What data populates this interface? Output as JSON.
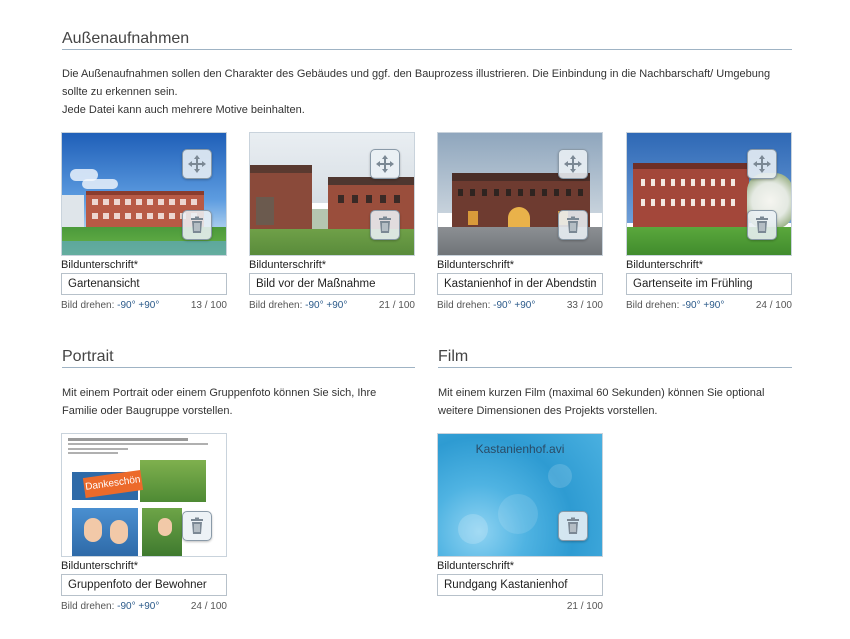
{
  "sections": {
    "exterior": {
      "title": "Außenaufnahmen",
      "description_line1": "Die Außenaufnahmen sollen den Charakter des Gebäudes und ggf. den Bauprozess illustrieren. Die Einbindung in die Nachbarschaft/ Umgebung",
      "description_line2": "sollte zu erkennen sein.",
      "description_line3": "Jede Datei kann auch mehrere Motive beinhalten."
    },
    "portrait": {
      "title": "Portrait",
      "description_line1": "Mit einem Portrait oder einem Gruppenfoto können Sie sich, Ihre",
      "description_line2": "Familie oder Baugruppe vorstellen."
    },
    "film": {
      "title": "Film",
      "description_line1": "Mit einem kurzen Film (maximal 60 Sekunden) können Sie optional",
      "description_line2": "weitere Dimensionen des Projekts vorstellen."
    }
  },
  "labels": {
    "caption": "Bildunterschrift*",
    "rotate": "Bild drehen:",
    "rotate_left": "-90°",
    "rotate_right": "+90°"
  },
  "exterior_cards": [
    {
      "caption": "Gartenansicht",
      "count": "13 / 100"
    },
    {
      "caption": "Bild vor der Maßnahme",
      "count": "21 / 100"
    },
    {
      "caption": "Kastanienhof in der Abendstimmung",
      "count": "33 / 100"
    },
    {
      "caption": "Gartenseite im Frühling",
      "count": "24 / 100"
    }
  ],
  "portrait_card": {
    "caption": "Gruppenfoto der Bewohner",
    "count": "24 / 100",
    "sign_text": "Dankeschön"
  },
  "film_card": {
    "file_name": "Kastanienhof.avi",
    "caption": "Rundgang Kastanienhof",
    "count": "21 / 100"
  },
  "icons": {
    "move": "move-arrows-icon",
    "delete": "trash-icon"
  },
  "colors": {
    "rule": "#9fb3c4",
    "link": "#2b5a8a",
    "film_bg": "#3aa6d8"
  }
}
